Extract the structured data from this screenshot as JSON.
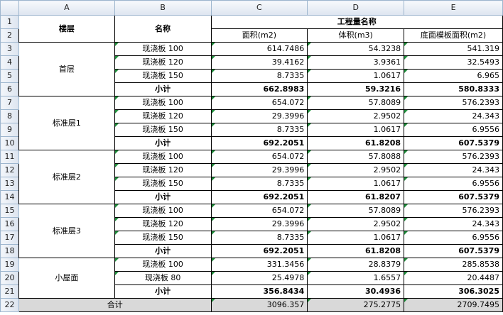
{
  "columns": [
    "A",
    "B",
    "C",
    "D",
    "E"
  ],
  "header": {
    "floor": "楼层",
    "name": "名称",
    "group": "工程量名称",
    "area": "面积(m2)",
    "volume": "体积(m3)",
    "bottom": "底面模板面积(m2)"
  },
  "row_numbers": [
    "1",
    "2",
    "3",
    "4",
    "5",
    "6",
    "7",
    "8",
    "9",
    "10",
    "11",
    "12",
    "13",
    "14",
    "15",
    "16",
    "17",
    "18",
    "19",
    "20",
    "21",
    "22"
  ],
  "groups": [
    {
      "floor": "首层",
      "items": [
        {
          "name": "现浇板 100",
          "area": "614.7486",
          "volume": "54.3238",
          "bottom": "541.319"
        },
        {
          "name": "现浇板 120",
          "area": "39.4162",
          "volume": "3.9361",
          "bottom": "32.5493"
        },
        {
          "name": "现浇板 150",
          "area": "8.7335",
          "volume": "1.0617",
          "bottom": "6.965"
        }
      ],
      "subtotal": {
        "label": "小计",
        "area": "662.8983",
        "volume": "59.3216",
        "bottom": "580.8333"
      }
    },
    {
      "floor": "标准层1",
      "items": [
        {
          "name": "现浇板 100",
          "area": "654.072",
          "volume": "57.8089",
          "bottom": "576.2393"
        },
        {
          "name": "现浇板 120",
          "area": "29.3996",
          "volume": "2.9502",
          "bottom": "24.343"
        },
        {
          "name": "现浇板 150",
          "area": "8.7335",
          "volume": "1.0617",
          "bottom": "6.9556"
        }
      ],
      "subtotal": {
        "label": "小计",
        "area": "692.2051",
        "volume": "61.8208",
        "bottom": "607.5379"
      }
    },
    {
      "floor": "标准层2",
      "items": [
        {
          "name": "现浇板 100",
          "area": "654.072",
          "volume": "57.8088",
          "bottom": "576.2393"
        },
        {
          "name": "现浇板 120",
          "area": "29.3996",
          "volume": "2.9502",
          "bottom": "24.343"
        },
        {
          "name": "现浇板 150",
          "area": "8.7335",
          "volume": "1.0617",
          "bottom": "6.9556"
        }
      ],
      "subtotal": {
        "label": "小计",
        "area": "692.2051",
        "volume": "61.8207",
        "bottom": "607.5379"
      }
    },
    {
      "floor": "标准层3",
      "items": [
        {
          "name": "现浇板 100",
          "area": "654.072",
          "volume": "57.8089",
          "bottom": "576.2393"
        },
        {
          "name": "现浇板 120",
          "area": "29.3996",
          "volume": "2.9502",
          "bottom": "24.343"
        },
        {
          "name": "现浇板 150",
          "area": "8.7335",
          "volume": "1.0617",
          "bottom": "6.9556"
        }
      ],
      "subtotal": {
        "label": "小计",
        "area": "692.2051",
        "volume": "61.8208",
        "bottom": "607.5379"
      }
    },
    {
      "floor": "小屋面",
      "items": [
        {
          "name": "现浇板 100",
          "area": "331.3456",
          "volume": "28.8379",
          "bottom": "285.8538"
        },
        {
          "name": "现浇板 80",
          "area": "25.4978",
          "volume": "1.6557",
          "bottom": "20.4487"
        }
      ],
      "subtotal": {
        "label": "小计",
        "area": "356.8434",
        "volume": "30.4936",
        "bottom": "306.3025"
      }
    }
  ],
  "total": {
    "label": "合计",
    "area": "3096.357",
    "volume": "275.2775",
    "bottom": "2709.7495"
  },
  "colors": {
    "header_border": "#9eb6ce",
    "error_triangle": "#1e8c3a",
    "total_fill": "#d9d9d9"
  }
}
